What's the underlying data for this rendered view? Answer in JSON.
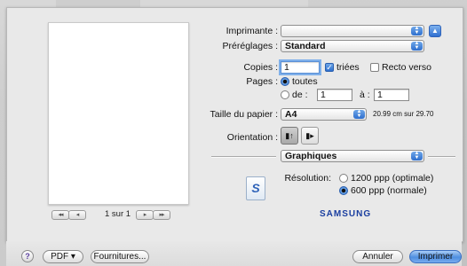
{
  "printer": {
    "label": "Imprimante :",
    "value": ""
  },
  "presets": {
    "label": "Préréglages :",
    "value": "Standard"
  },
  "copies": {
    "label": "Copies :",
    "value": "1",
    "collated_label": "triées",
    "collated": true,
    "duplex_label": "Recto verso",
    "duplex": false
  },
  "pages": {
    "label": "Pages :",
    "all_label": "toutes",
    "from_label": "de :",
    "from_value": "1",
    "to_label": "à :",
    "to_value": "1",
    "selected": "all"
  },
  "paper_size": {
    "label": "Taille du papier :",
    "value": "A4",
    "dimensions": "20.99 cm sur 29.70"
  },
  "orientation": {
    "label": "Orientation :",
    "selected": "portrait"
  },
  "section": {
    "value": "Graphiques"
  },
  "resolution": {
    "label": "Résolution:",
    "options": [
      "1200 ppp (optimale)",
      "600 ppp (normale)"
    ],
    "selected_index": 1
  },
  "brand": "SAMSUNG",
  "preview": {
    "page_indicator": "1 sur 1"
  },
  "footer": {
    "help": "?",
    "pdf_label": "PDF ▾",
    "supplies_label": "Fournitures...",
    "cancel_label": "Annuler",
    "print_label": "Imprimer"
  }
}
